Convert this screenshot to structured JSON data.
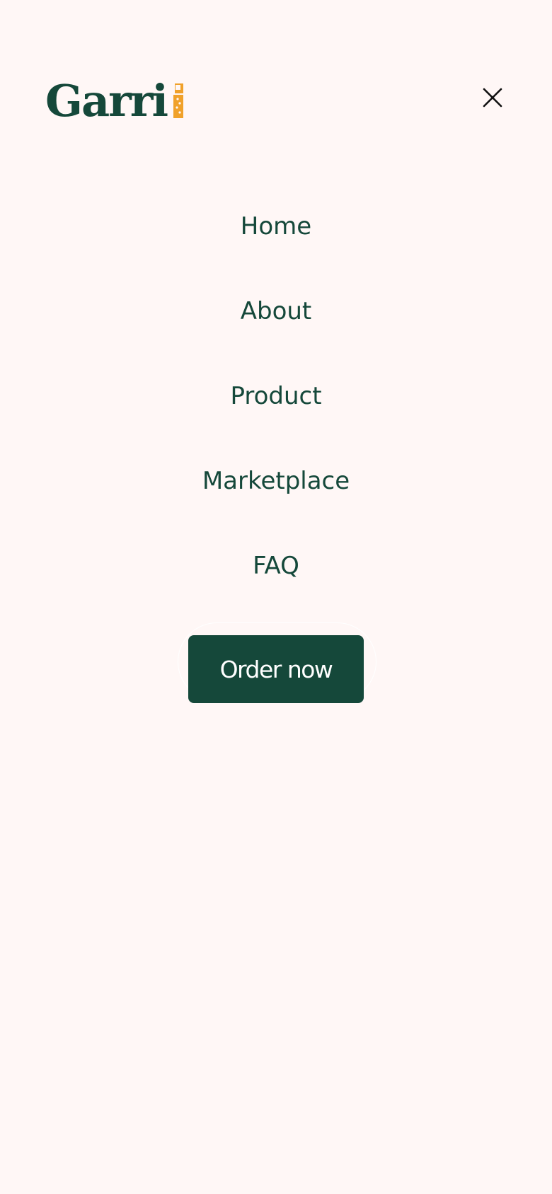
{
  "header": {
    "logo_text": "Garri",
    "logo_icon": "garri-logo",
    "close_icon": "close-icon"
  },
  "nav": {
    "items": [
      {
        "label": "Home"
      },
      {
        "label": "About"
      },
      {
        "label": "Product"
      },
      {
        "label": "Marketplace"
      },
      {
        "label": "FAQ"
      }
    ]
  },
  "cta": {
    "label": "Order now"
  },
  "colors": {
    "background": "#fff7f6",
    "brand_green": "#15483a",
    "accent_orange": "#f0a12a"
  }
}
